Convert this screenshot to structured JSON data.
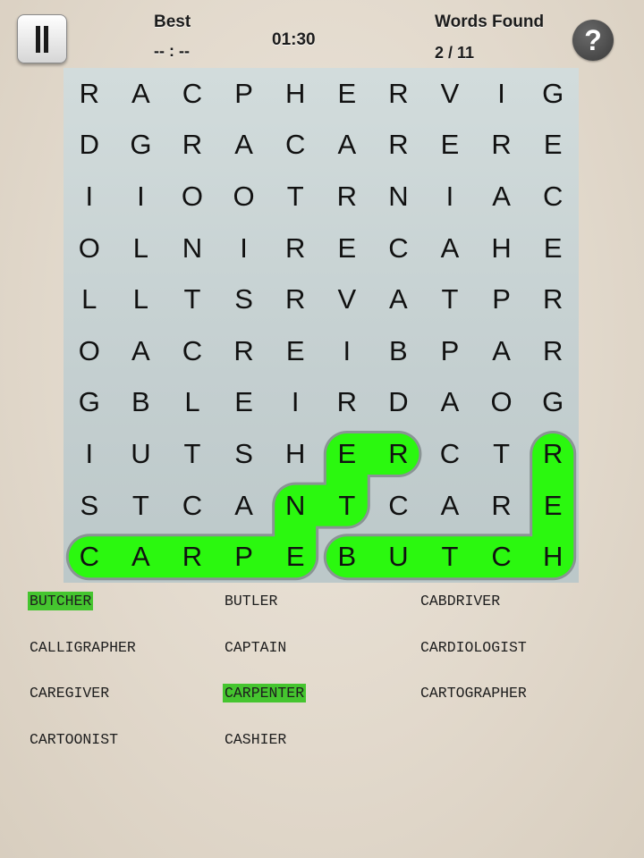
{
  "header": {
    "best_label": "Best",
    "best_value": "-- : --",
    "timer": "01:30",
    "words_found_label": "Words Found",
    "words_found_value": "2 / 11",
    "help_symbol": "?"
  },
  "icons": {
    "pause": "pause-icon",
    "help": "question-mark-icon"
  },
  "colors": {
    "highlight": "#2bf80f",
    "found_word_bg": "#45c52f",
    "board_bg": "#c8d2d3",
    "page_bg": "#e4dccf"
  },
  "grid": [
    [
      "R",
      "A",
      "C",
      "P",
      "H",
      "E",
      "R",
      "V",
      "I",
      "G"
    ],
    [
      "D",
      "G",
      "R",
      "A",
      "C",
      "A",
      "R",
      "E",
      "R",
      "E"
    ],
    [
      "I",
      "I",
      "O",
      "O",
      "T",
      "R",
      "N",
      "I",
      "A",
      "C"
    ],
    [
      "O",
      "L",
      "N",
      "I",
      "R",
      "E",
      "C",
      "A",
      "H",
      "E"
    ],
    [
      "L",
      "L",
      "T",
      "S",
      "R",
      "V",
      "A",
      "T",
      "P",
      "R"
    ],
    [
      "O",
      "A",
      "C",
      "R",
      "E",
      "I",
      "B",
      "P",
      "A",
      "R"
    ],
    [
      "G",
      "B",
      "L",
      "E",
      "I",
      "R",
      "D",
      "A",
      "O",
      "G"
    ],
    [
      "I",
      "U",
      "T",
      "S",
      "H",
      "E",
      "R",
      "C",
      "T",
      "R"
    ],
    [
      "S",
      "T",
      "C",
      "A",
      "N",
      "T",
      "C",
      "A",
      "R",
      "E"
    ],
    [
      "C",
      "A",
      "R",
      "P",
      "E",
      "B",
      "U",
      "T",
      "C",
      "H"
    ]
  ],
  "found_paths": [
    {
      "word": "CARPENTER",
      "cells": [
        [
          9,
          0
        ],
        [
          9,
          1
        ],
        [
          9,
          2
        ],
        [
          9,
          3
        ],
        [
          9,
          4
        ],
        [
          8,
          4
        ],
        [
          8,
          5
        ],
        [
          7,
          5
        ],
        [
          7,
          6
        ]
      ]
    },
    {
      "word": "BUTCHER",
      "cells": [
        [
          9,
          5
        ],
        [
          9,
          6
        ],
        [
          9,
          7
        ],
        [
          9,
          8
        ],
        [
          9,
          9
        ],
        [
          8,
          9
        ],
        [
          7,
          9
        ]
      ]
    }
  ],
  "words": [
    {
      "label": "BUTCHER",
      "found": true
    },
    {
      "label": "BUTLER",
      "found": false
    },
    {
      "label": "CABDRIVER",
      "found": false
    },
    {
      "label": "CALLIGRAPHER",
      "found": false
    },
    {
      "label": "CAPTAIN",
      "found": false
    },
    {
      "label": "CARDIOLOGIST",
      "found": false
    },
    {
      "label": "CAREGIVER",
      "found": false
    },
    {
      "label": "CARPENTER",
      "found": true
    },
    {
      "label": "CARTOGRAPHER",
      "found": false
    },
    {
      "label": "CARTOONIST",
      "found": false
    },
    {
      "label": "CASHIER",
      "found": false
    }
  ]
}
